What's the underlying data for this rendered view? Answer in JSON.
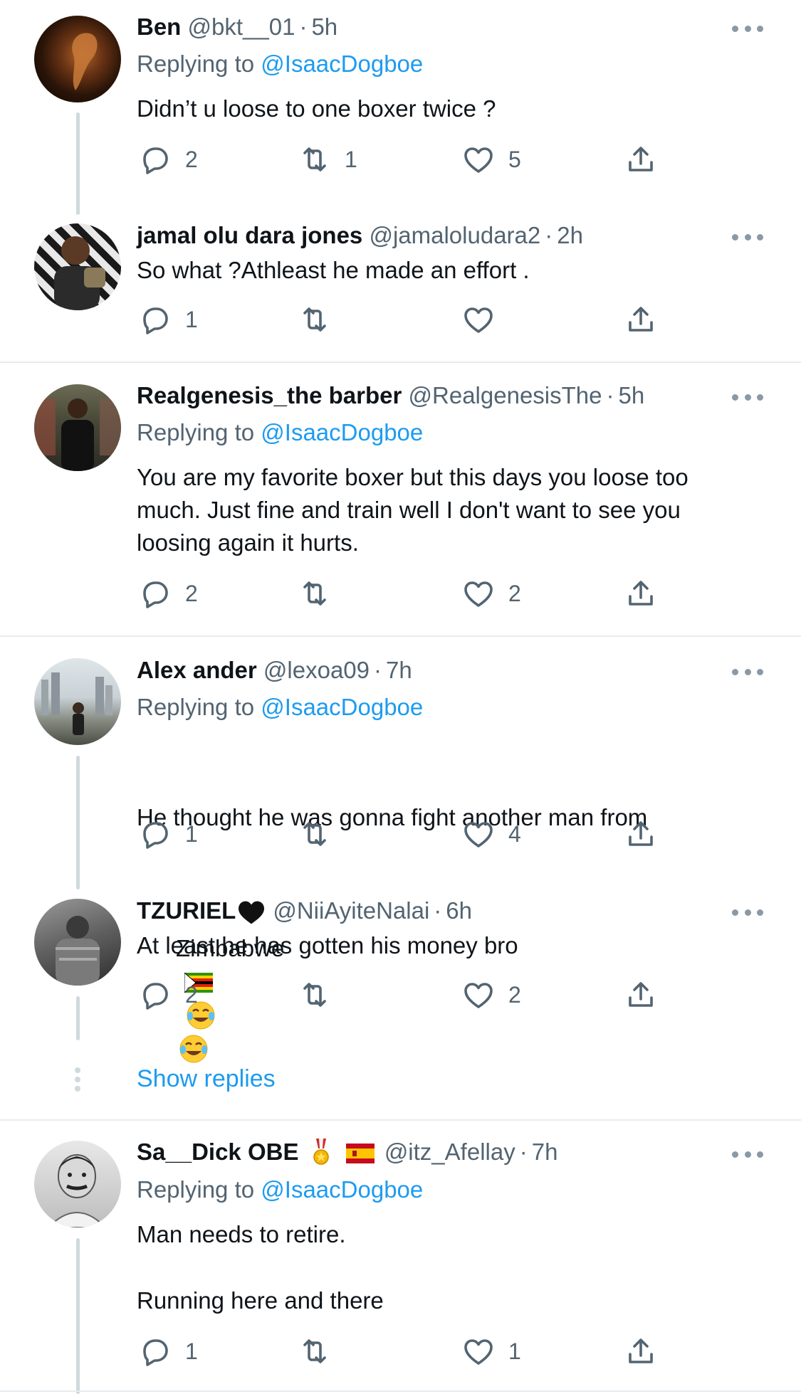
{
  "tweets": [
    {
      "name": "Ben",
      "handle": "@bkt__01",
      "time": "5h",
      "replying_label": "Replying to",
      "replying_to": "@IsaacDogboe",
      "text": "Didn’t u loose to one boxer twice ?",
      "replies": "2",
      "retweets": "1",
      "likes": "5"
    },
    {
      "name": "jamal olu dara jones",
      "handle": "@jamaloludara2",
      "time": "2h",
      "text": "So what ?Athleast he made an effort .",
      "replies": "1",
      "retweets": "",
      "likes": ""
    },
    {
      "name": "Realgenesis_the barber",
      "handle": "@RealgenesisThe",
      "time": "5h",
      "replying_label": "Replying to",
      "replying_to": "@IsaacDogboe",
      "text": "You are my favorite boxer but this days you loose too\nmuch. Just fine and train well I don't want to see you\nloosing again it hurts.",
      "replies": "2",
      "retweets": "",
      "likes": "2"
    },
    {
      "name": "Alex ander",
      "handle": "@lexoa09",
      "time": "7h",
      "replying_label": "Replying to",
      "replying_to": "@IsaacDogboe",
      "text_line1": "He thought he was gonna fight another man from",
      "text_line2": "Zimbabwe",
      "emojis": [
        "zimbabwe-flag",
        "tears-of-joy",
        "tears-of-joy"
      ],
      "replies": "1",
      "retweets": "",
      "likes": "4"
    },
    {
      "name": "TZURIEL",
      "name_emoji": "black-heart",
      "handle": "@NiiAyiteNalai",
      "time": "6h",
      "text": "At least he has gotten his money bro",
      "replies": "2",
      "retweets": "",
      "likes": "2"
    },
    {
      "name": "Sa__Dick OBE",
      "name_emojis": [
        "military-medal",
        "spain-flag"
      ],
      "handle": "@itz_Afellay",
      "time": "7h",
      "replying_label": "Replying to",
      "replying_to": "@IsaacDogboe",
      "text_line1": "Man needs to retire.",
      "text_line2": "Running here and there",
      "replies": "1",
      "retweets": "",
      "likes": "1"
    }
  ],
  "show_replies": "Show replies",
  "separator": "·",
  "colors": {
    "link": "#1d9bf0",
    "muted": "#536471",
    "text": "#0f1419",
    "line": "#cfd9de"
  }
}
